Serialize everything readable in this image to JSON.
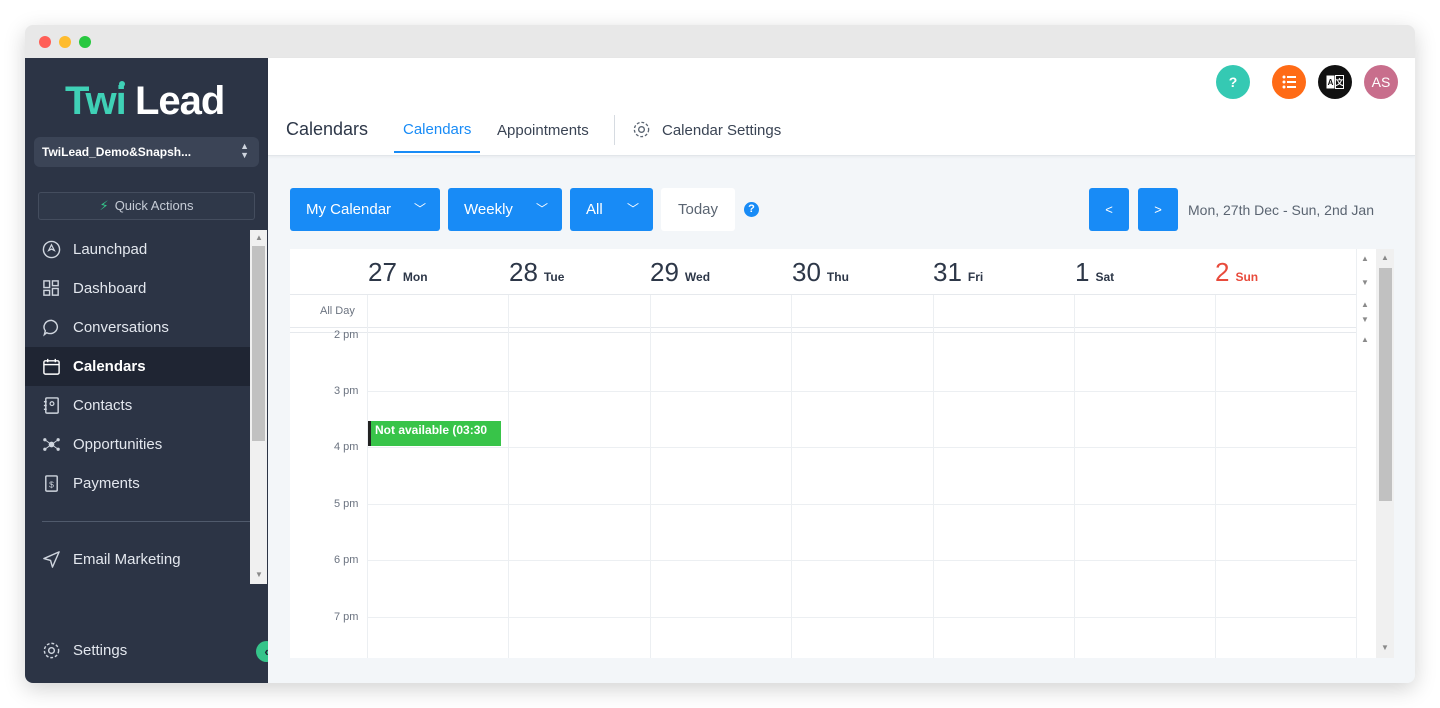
{
  "window": {
    "dots": [
      "#ff5f57",
      "#febc2e",
      "#28c840"
    ]
  },
  "sidebar": {
    "logo_text": "TwiLead",
    "account_name": "TwiLead_Demo&Snapsh...",
    "quick_actions": "Quick Actions",
    "items": [
      {
        "label": "Launchpad",
        "icon": "rocket-icon"
      },
      {
        "label": "Dashboard",
        "icon": "grid-icon"
      },
      {
        "label": "Conversations",
        "icon": "chat-icon"
      },
      {
        "label": "Calendars",
        "icon": "calendar-icon",
        "active": true
      },
      {
        "label": "Contacts",
        "icon": "contacts-icon"
      },
      {
        "label": "Opportunities",
        "icon": "opportunities-icon"
      },
      {
        "label": "Payments",
        "icon": "payments-icon"
      }
    ],
    "email_marketing": "Email Marketing",
    "settings": "Settings"
  },
  "header": {
    "title": "Calendars",
    "tabs": [
      "Calendars",
      "Appointments",
      "Calendar Settings"
    ],
    "avatar": "AS",
    "help": "?",
    "colors": {
      "help": "#35c9b3",
      "list": "#ff6b16",
      "translate": "#111111",
      "avatar": "#c86e8c"
    }
  },
  "toolbar": {
    "calendar_select": "My Calendar",
    "view_select": "Weekly",
    "filter_select": "All",
    "today": "Today",
    "help": "?",
    "prev": "<",
    "next": ">",
    "date_range": "Mon, 27th Dec - Sun, 2nd Jan"
  },
  "calendar": {
    "days": [
      {
        "num": "27",
        "name": "Mon"
      },
      {
        "num": "28",
        "name": "Tue"
      },
      {
        "num": "29",
        "name": "Wed"
      },
      {
        "num": "30",
        "name": "Thu"
      },
      {
        "num": "31",
        "name": "Fri"
      },
      {
        "num": "1",
        "name": "Sat"
      },
      {
        "num": "2",
        "name": "Sun"
      }
    ],
    "all_day": "All Day",
    "times": [
      "2 pm",
      "3 pm",
      "4 pm",
      "5 pm",
      "6 pm",
      "7 pm"
    ],
    "event": {
      "title": "Not available (03:30"
    },
    "accent": "#188bf6",
    "sunday_color": "#e84b3c",
    "event_color": "#38c449"
  }
}
